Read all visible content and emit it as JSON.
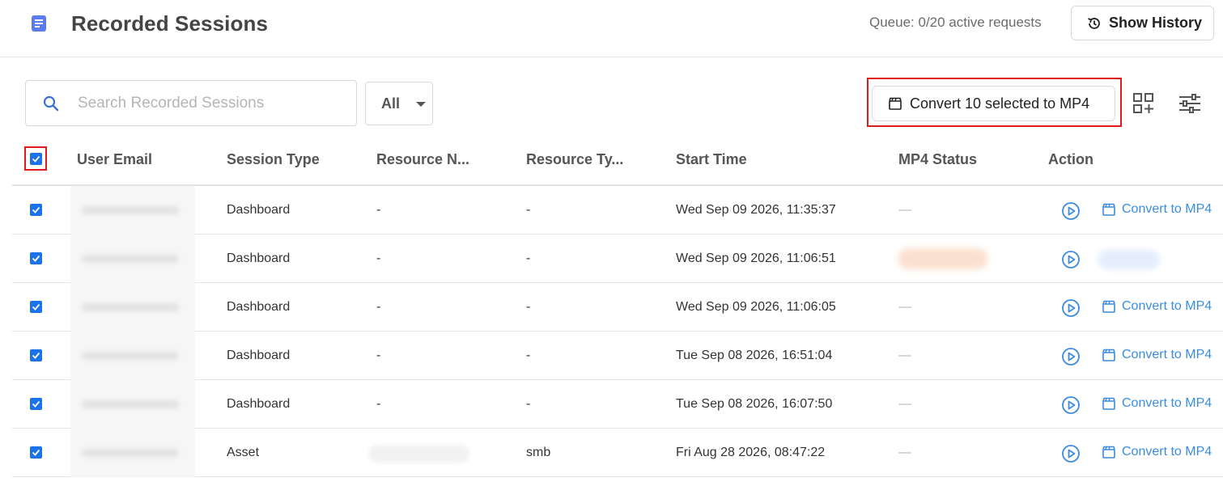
{
  "header": {
    "title": "Recorded Sessions",
    "queue_text": "Queue: 0/20 active requests",
    "history_button": "Show History"
  },
  "toolbar": {
    "search_placeholder": "Search Recorded Sessions",
    "filter_value": "All",
    "convert_selected_label": "Convert 10 selected to MP4"
  },
  "table": {
    "columns": [
      "User Email",
      "Session Type",
      "Resource N...",
      "Resource Ty...",
      "Start Time",
      "MP4 Status",
      "Action"
    ],
    "action_link_label": "Convert to MP4",
    "rows": [
      {
        "session_type": "Dashboard",
        "resource_name": "-",
        "resource_type": "-",
        "start_time": "Wed Sep 09 2026, 11:35:37",
        "mp4_status": "—"
      },
      {
        "session_type": "Dashboard",
        "resource_name": "-",
        "resource_type": "-",
        "start_time": "Wed Sep 09 2026, 11:06:51",
        "mp4_status": ""
      },
      {
        "session_type": "Dashboard",
        "resource_name": "-",
        "resource_type": "-",
        "start_time": "Wed Sep 09 2026, 11:06:05",
        "mp4_status": "—"
      },
      {
        "session_type": "Dashboard",
        "resource_name": "-",
        "resource_type": "-",
        "start_time": "Tue Sep 08 2026, 16:51:04",
        "mp4_status": "—"
      },
      {
        "session_type": "Dashboard",
        "resource_name": "-",
        "resource_type": "-",
        "start_time": "Tue Sep 08 2026, 16:07:50",
        "mp4_status": "—"
      },
      {
        "session_type": "Asset",
        "resource_name": "",
        "resource_type": "smb",
        "start_time": "Fri Aug 28 2026, 08:47:22",
        "mp4_status": "—"
      }
    ]
  },
  "colors": {
    "accent": "#1a73e8",
    "link": "#3b8ce0",
    "highlight": "#e0191b"
  },
  "icons": [
    "document-icon",
    "history-icon",
    "search-icon",
    "clapperboard-icon",
    "grid-add-icon",
    "sliders-icon",
    "play-icon",
    "check-icon"
  ]
}
